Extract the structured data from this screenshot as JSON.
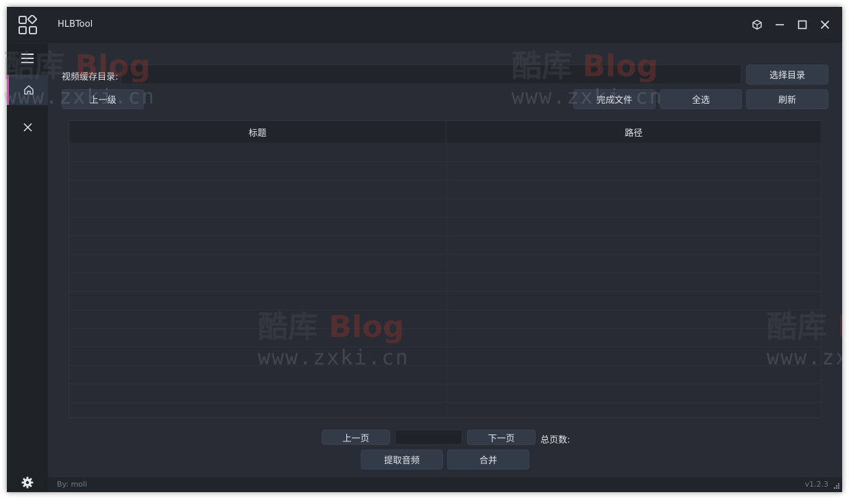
{
  "window": {
    "title": "HLBTool",
    "accent_color": "#bd5fa8"
  },
  "titlebar_icons": [
    "app-grid-icon",
    "cube-icon",
    "minimize-icon",
    "maximize-icon",
    "close-icon"
  ],
  "sidebar": {
    "items": [
      {
        "icon": "hamburger-menu-icon"
      },
      {
        "icon": "home-icon",
        "active": true
      },
      {
        "icon": "close-icon"
      }
    ],
    "settings_icon": "gear-icon"
  },
  "toolbar": {
    "dir_label": "视频缓存目录:",
    "dir_value": "",
    "select_dir": "选择目录",
    "up_level": "上一级",
    "done_files": "完成文件",
    "select_all": "全选",
    "refresh": "刷新"
  },
  "table": {
    "columns": [
      "标题",
      "路径"
    ],
    "rows": []
  },
  "pagination": {
    "prev_page": "上一页",
    "page_input": "",
    "next_page": "下一页",
    "total_pages_label": "总页数:"
  },
  "actions": {
    "extract_audio": "提取音频",
    "merge": "合并"
  },
  "status": {
    "author": "By: moli",
    "version": "v1.2.3"
  },
  "watermark": {
    "top_cn": "酷库",
    "top_en": "Blog",
    "bottom": "www.zxki.cn"
  }
}
